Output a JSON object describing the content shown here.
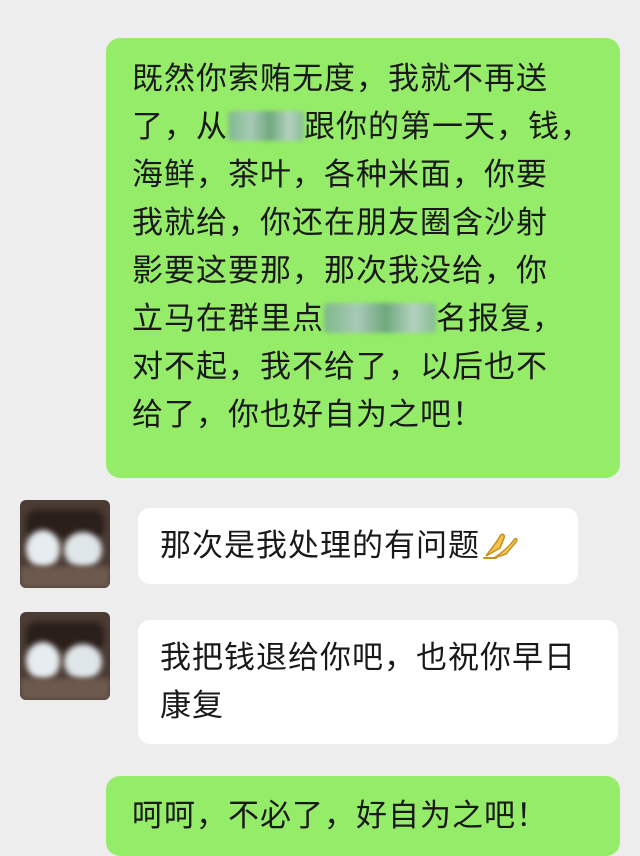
{
  "messages": [
    {
      "side": "out",
      "segments": [
        "既然你索贿无度，我就不再送",
        "了，从",
        "跟你的第一天，钱，",
        "海鲜，茶叶，各种米面，你要",
        "我就给，你还在朋友圈含沙射",
        "影要这要那，那次我没给，你",
        "立马在群里点",
        "名报复，",
        "对不起，我不给了，以后也不",
        "给了，你也好自为之吧！"
      ]
    },
    {
      "side": "in",
      "text": "那次是我处理的有问题",
      "emoji": "folded-hands-icon"
    },
    {
      "side": "in",
      "lines": [
        "我把钱退给你吧，也祝你早日",
        "康复"
      ]
    },
    {
      "side": "out",
      "text": "呵呵，不必了，好自为之吧！"
    }
  ],
  "colors": {
    "background": "#ededed",
    "outgoing_bubble": "#95ec69",
    "incoming_bubble": "#ffffff",
    "text": "#191919"
  }
}
